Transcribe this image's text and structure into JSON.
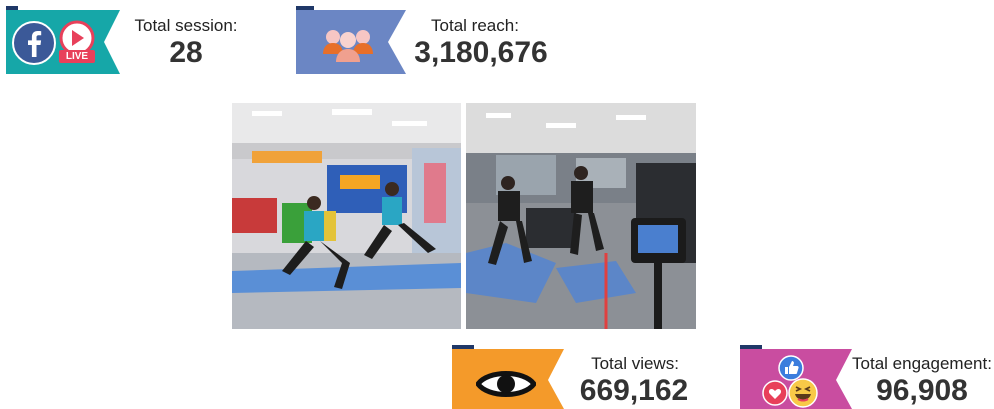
{
  "stats": {
    "session": {
      "label": "Total session:",
      "value": "28"
    },
    "reach": {
      "label": "Total reach:",
      "value": "3,180,676"
    },
    "views": {
      "label": "Total views:",
      "value": "669,162"
    },
    "engagement": {
      "label": "Total engagement:",
      "value": "96,908"
    }
  },
  "icons": {
    "facebook_live": "LIVE"
  },
  "colors": {
    "teal": "#16a7a8",
    "slate_blue": "#6b86c4",
    "orange": "#f49a2a",
    "magenta": "#c94da0",
    "navy_fold": "#1f3868",
    "facebook_blue": "#3b5998",
    "live_red": "#e8405a"
  }
}
